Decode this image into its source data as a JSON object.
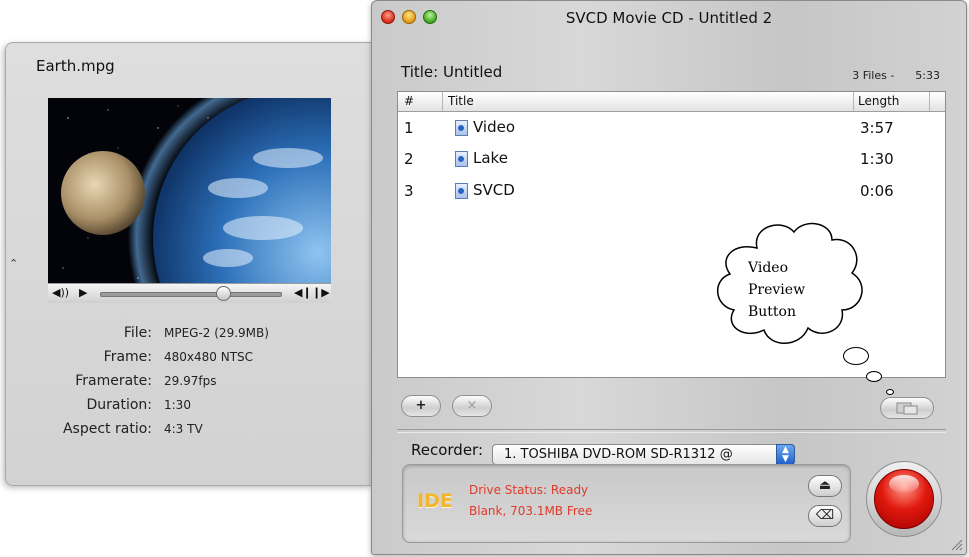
{
  "drawer": {
    "filename": "Earth.mpg",
    "info": [
      {
        "label": "File:",
        "value": "MPEG-2 (29.9MB)"
      },
      {
        "label": "Frame:",
        "value": "480x480 NTSC"
      },
      {
        "label": "Framerate:",
        "value": "29.97fps"
      },
      {
        "label": "Duration:",
        "value": "1:30"
      },
      {
        "label": "Aspect ratio:",
        "value": "4:3 TV"
      }
    ],
    "controller": {
      "volume_icon": "speaker-icon",
      "play_icon": "play-icon",
      "step_back_icon": "step-back-icon",
      "step_forward_icon": "step-forward-icon",
      "scrub_position": 0.68
    }
  },
  "window": {
    "title": "SVCD Movie CD - Untitled 2",
    "title_label": "Title:  Untitled",
    "summary": "3 Files -      5:33",
    "columns": [
      "#",
      "Title",
      "Length"
    ],
    "rows": [
      {
        "num": "1",
        "title": "Video",
        "length": "3:57"
      },
      {
        "num": "2",
        "title": "Lake",
        "length": "1:30"
      },
      {
        "num": "3",
        "title": "SVCD",
        "length": "0:06"
      }
    ],
    "add_label": "+",
    "remove_label": "×",
    "annotation": [
      "Video",
      "Preview",
      "Button"
    ],
    "recorder_label": "Recorder:",
    "recorder_value": "1. TOSHIBA DVD-ROM SD-R1312 @",
    "ide_badge": "IDE",
    "drive_status": "Drive Status: Ready",
    "disc_status": "Blank, 703.1MB Free",
    "eject_glyph": "⏏",
    "erase_glyph": "⌫"
  },
  "colors": {
    "status_red": "#e03a2a",
    "ide_orange": "#f5b52a",
    "burn_red": "#e0190e"
  }
}
